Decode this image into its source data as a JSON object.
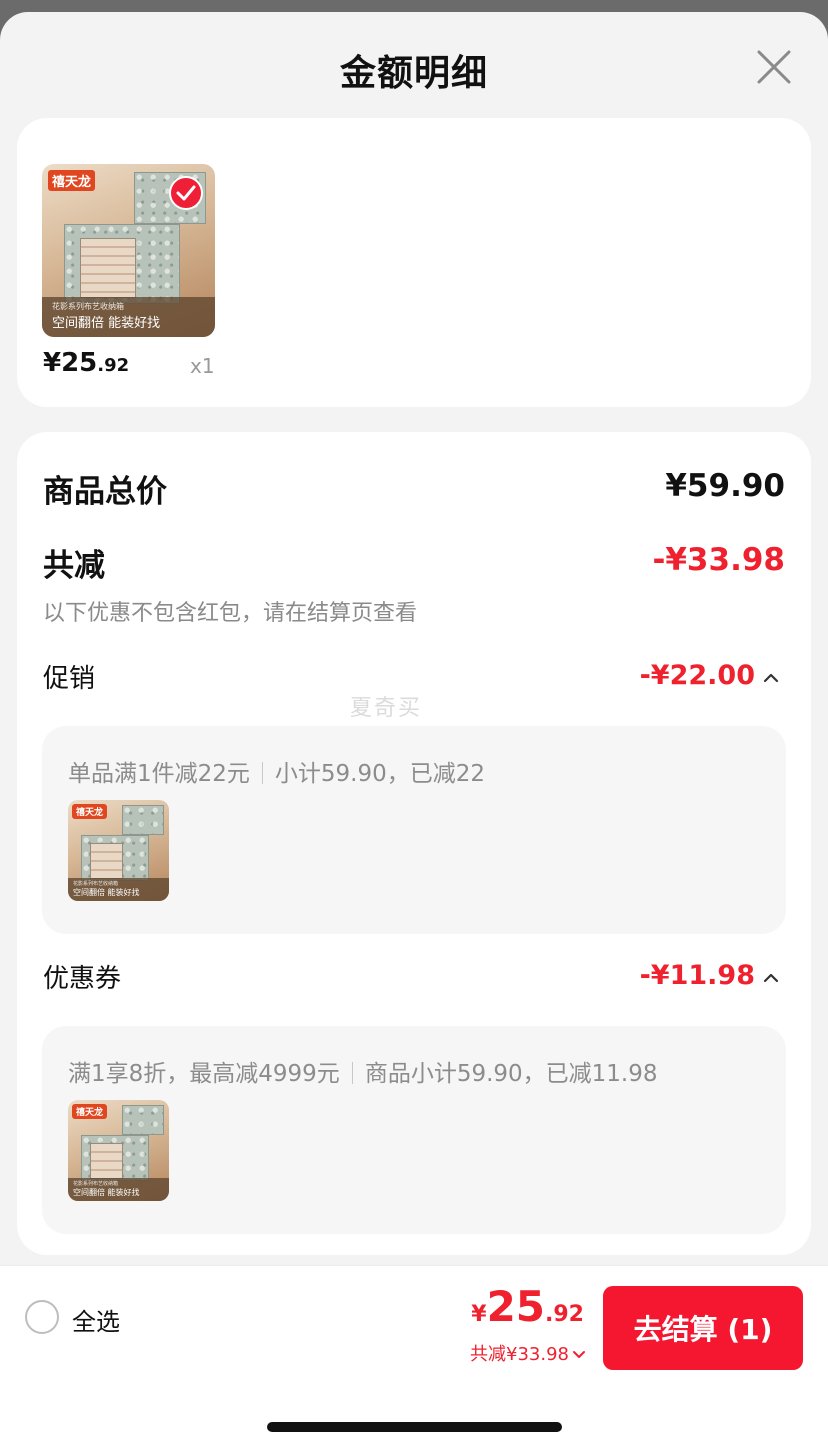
{
  "header": {
    "title": "金额明细"
  },
  "product": {
    "brand": "禧天龙",
    "caption_small": "花影系列布艺收纳箱",
    "caption": "空间翻倍 能装好找",
    "price_int": "¥25",
    "price_dec": ".92",
    "quantity": "x1"
  },
  "summary": {
    "total_label": "商品总价",
    "total_value": "¥59.90",
    "discount_label": "共减",
    "discount_value": "-¥33.98",
    "note": "以下优惠不包含红包，请在结算页查看"
  },
  "promotion": {
    "label": "促销",
    "value": "-¥22.00",
    "rule": "单品满1件减22元",
    "detail": "小计59.90，已减22"
  },
  "coupon": {
    "label": "优惠券",
    "value": "-¥11.98",
    "rule": "满1享8折，最高减4999元",
    "detail": "商品小计59.90，已减11.98"
  },
  "watermark": "夏奇买",
  "bottom_bar": {
    "select_all": "全选",
    "price_symbol": "¥",
    "price_int": "25",
    "price_dec": ".92",
    "discount": "共减¥33.98",
    "checkout": "去结算 (1)"
  },
  "colors": {
    "accent": "#f5162f",
    "discount_red": "#f0212f",
    "background": "#f3f3f3"
  },
  "icons": {
    "close": "close-icon",
    "check": "check-icon",
    "caret": "chevron-up-icon",
    "chevron_down": "chevron-down-icon"
  }
}
